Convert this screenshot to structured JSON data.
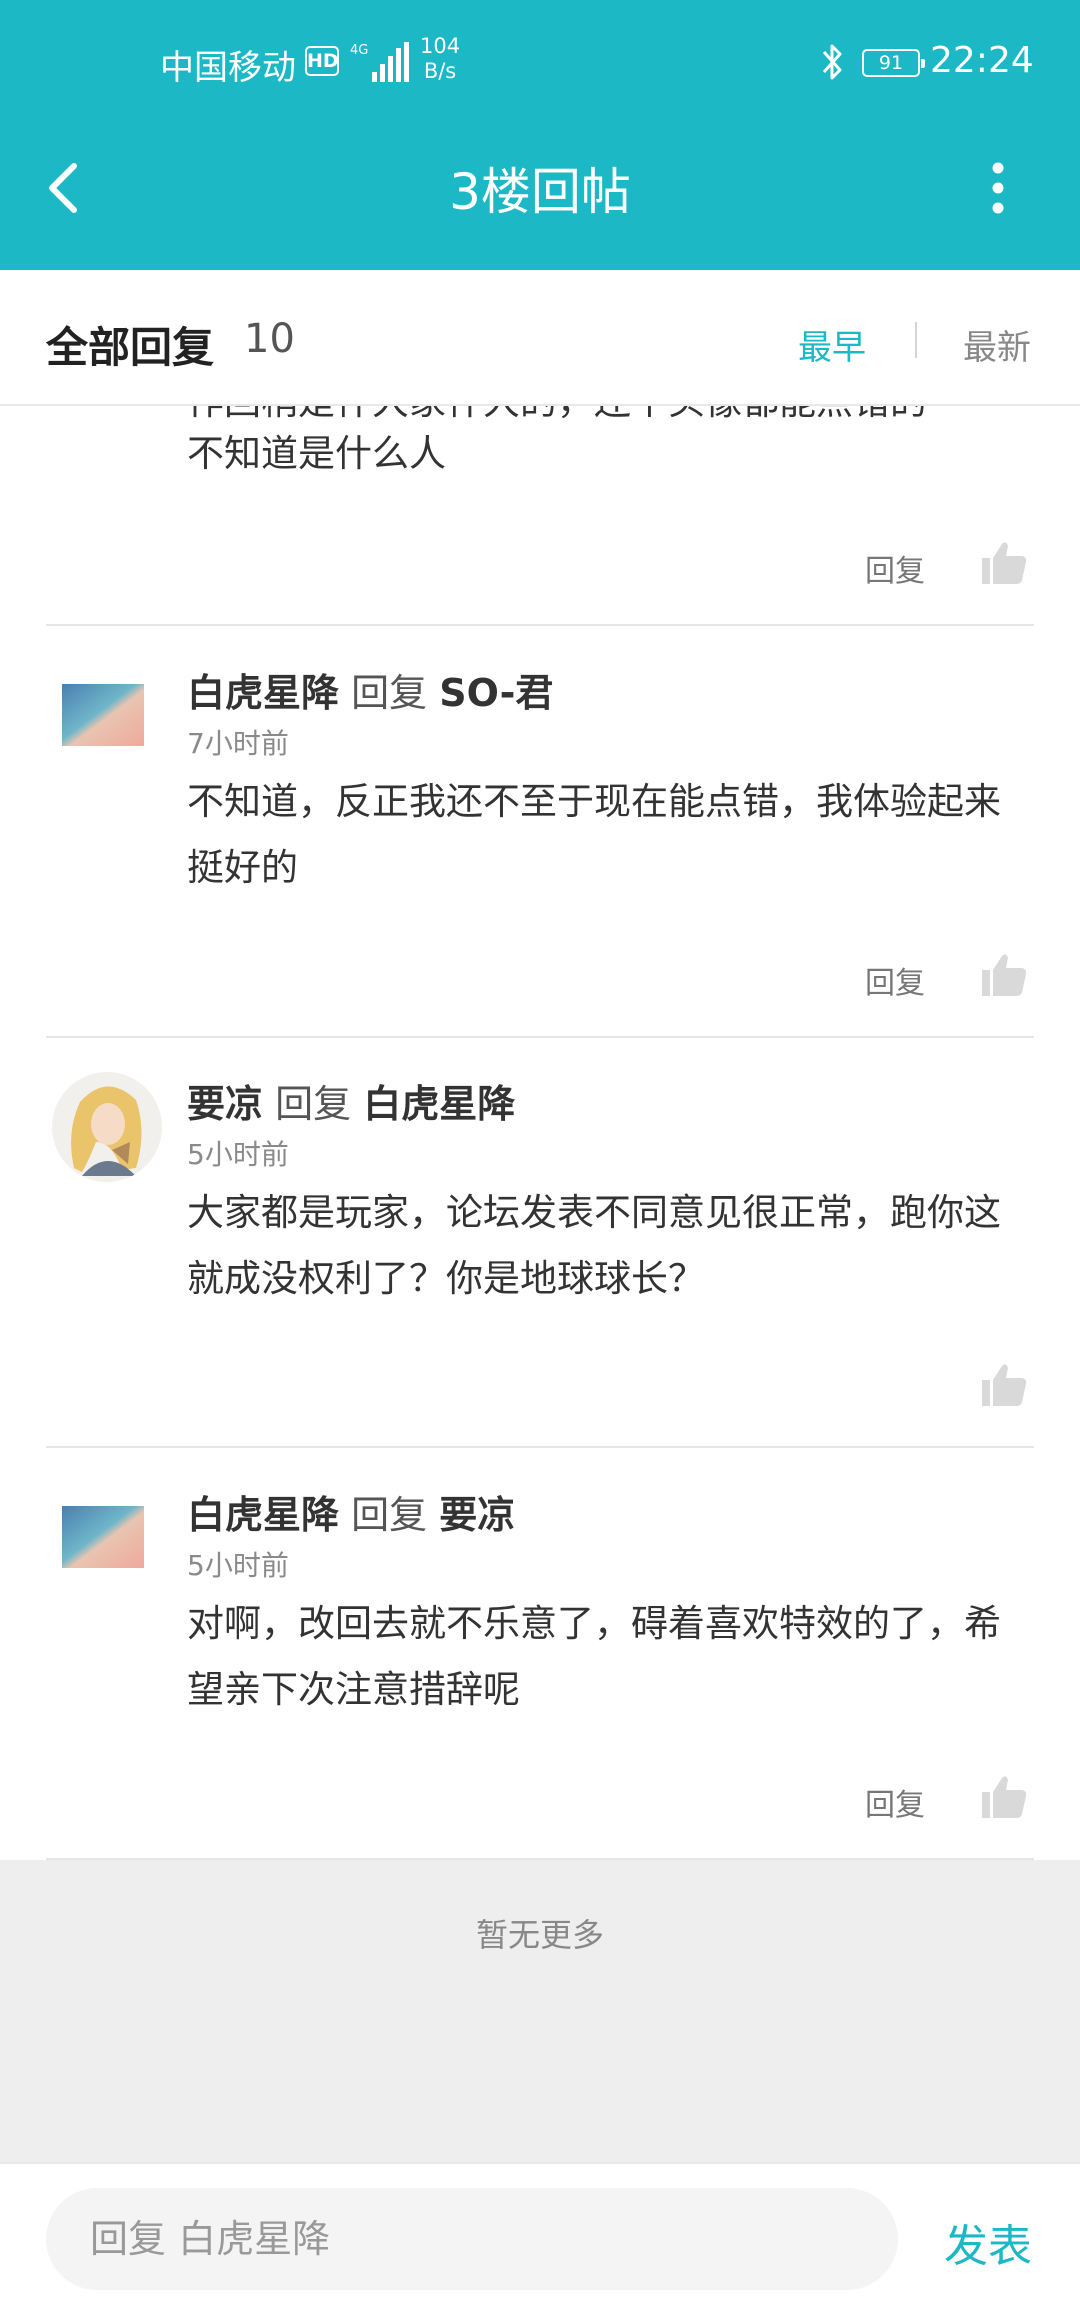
{
  "status_bar": {
    "carrier": "中国移动",
    "hd": "HD",
    "network": "4G",
    "speed_value": "104",
    "speed_unit": "B/s",
    "battery": "91",
    "time": "22:24"
  },
  "nav": {
    "title": "3楼回帖"
  },
  "header": {
    "title": "全部回复",
    "count": "10",
    "sort_earliest": "最早",
    "sort_latest": "最新"
  },
  "partial_comment": {
    "line1": "作回稍是什大家什大的，还个头像都能点错的",
    "line2": "不知道是什么人",
    "reply_label": "回复"
  },
  "comments": [
    {
      "author": "白虎星降",
      "reply_word": "回复",
      "target": "SO-君",
      "time": "7小时前",
      "text": "不知道，反正我还不至于现在能点错，我体验起来挺好的",
      "reply_label": "回复"
    },
    {
      "author": "要凉",
      "reply_word": "回复",
      "target": "白虎星降",
      "time": "5小时前",
      "text": "大家都是玩家，论坛发表不同意见很正常，跑你这就成没权利了？你是地球球长？"
    },
    {
      "author": "白虎星降",
      "reply_word": "回复",
      "target": "要凉",
      "time": "5小时前",
      "text": "对啊，改回去就不乐意了，碍着喜欢特效的了，希望亲下次注意措辞呢",
      "reply_label": "回复"
    }
  ],
  "footer": {
    "no_more": "暂无更多",
    "input_placeholder": "回复 白虎星降",
    "send": "发表"
  },
  "colors": {
    "accent": "#1cb8c6",
    "background": "#ffffff",
    "footer_bg": "#eeeeee"
  }
}
